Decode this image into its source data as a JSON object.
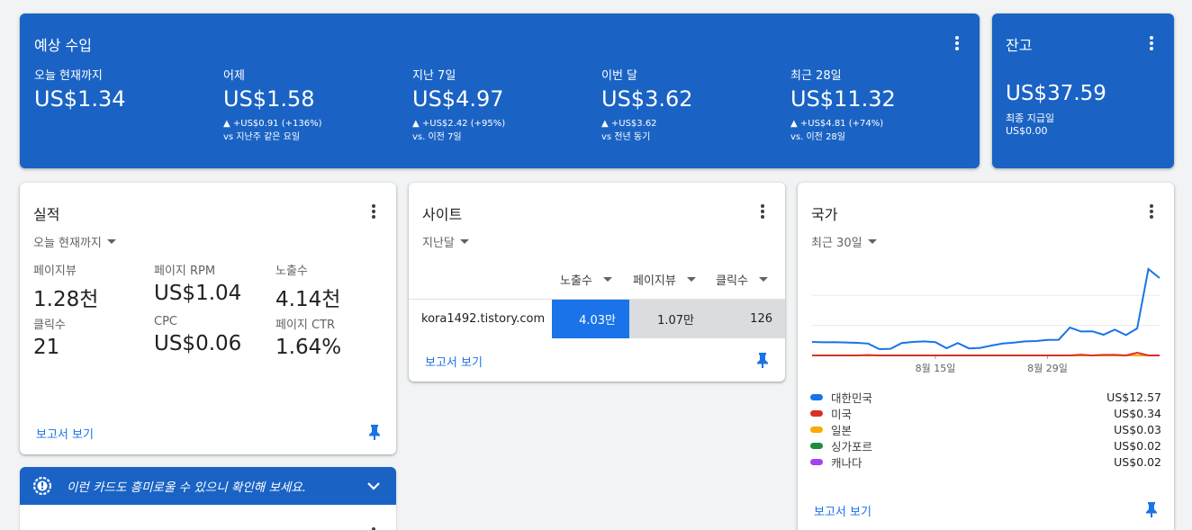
{
  "earnings": {
    "title": "예상 수입",
    "metrics": [
      {
        "label": "오늘 현재까지",
        "value": "US$1.34",
        "change": "",
        "compare": ""
      },
      {
        "label": "어제",
        "value": "US$1.58",
        "change": "▲ +US$0.91 (+136%)",
        "compare": "vs 지난주 같은 요일"
      },
      {
        "label": "지난 7일",
        "value": "US$4.97",
        "change": "▲ +US$2.42 (+95%)",
        "compare": "vs. 이전 7일"
      },
      {
        "label": "이번 달",
        "value": "US$3.62",
        "change": "▲ +US$3.62",
        "compare": "vs 전년 동기"
      },
      {
        "label": "최근 28일",
        "value": "US$11.32",
        "change": "▲ +US$4.81 (+74%)",
        "compare": "vs. 이전 28일"
      }
    ]
  },
  "balance": {
    "title": "잔고",
    "value": "US$37.59",
    "last_payment_label": "최종 지급일",
    "last_payment_value": "US$0.00"
  },
  "performance": {
    "title": "실적",
    "period": "오늘 현재까지",
    "metrics": [
      {
        "label": "페이지뷰",
        "value": "1.28천"
      },
      {
        "label": "페이지 RPM",
        "value": "US$1.04"
      },
      {
        "label": "노출수",
        "value": "4.14천"
      },
      {
        "label": "클릭수",
        "value": "21"
      },
      {
        "label": "CPC",
        "value": "US$0.06"
      },
      {
        "label": "페이지 CTR",
        "value": "1.64%"
      }
    ],
    "report_link": "보고서 보기"
  },
  "sites": {
    "title": "사이트",
    "period": "지난달",
    "columns": [
      "노출수",
      "페이지뷰",
      "클릭수"
    ],
    "rows": [
      {
        "site": "kora1492.tistory.com",
        "impressions": "4.03만",
        "pageviews": "1.07만",
        "clicks": "126"
      }
    ],
    "report_link": "보고서 보기"
  },
  "countries": {
    "title": "국가",
    "period": "최근 30일",
    "report_link": "보고서 보기",
    "legend": [
      {
        "name": "대한민국",
        "amount": "US$12.57",
        "color": "#1a73e8"
      },
      {
        "name": "미국",
        "amount": "US$0.34",
        "color": "#d93025"
      },
      {
        "name": "일본",
        "amount": "US$0.03",
        "color": "#f9ab00"
      },
      {
        "name": "싱가포르",
        "amount": "US$0.02",
        "color": "#1e8e3e"
      },
      {
        "name": "캐나다",
        "amount": "US$0.02",
        "color": "#a142f4"
      }
    ],
    "chart_data": {
      "type": "line",
      "x_ticks": [
        "8월 15일",
        "8월 29일"
      ],
      "series": [
        {
          "name": "대한민국",
          "color": "#1a73e8",
          "values": [
            0.75,
            0.73,
            0.74,
            0.72,
            0.7,
            0.66,
            0.35,
            0.37,
            0.69,
            0.75,
            0.78,
            0.74,
            0.4,
            0.69,
            0.39,
            0.42,
            0.55,
            0.66,
            0.71,
            0.78,
            0.8,
            0.86,
            0.87,
            1.55,
            1.33,
            1.34,
            1.15,
            1.43,
            1.13,
            1.5,
            4.8,
            4.3
          ]
        },
        {
          "name": "미국",
          "color": "#d93025",
          "values": [
            0,
            0,
            0,
            0,
            0,
            0.02,
            0,
            0,
            0,
            0,
            0,
            0,
            0,
            0,
            0,
            0,
            0,
            0,
            0,
            0,
            0,
            0,
            0,
            0,
            0.04,
            0,
            0.03,
            0.03,
            0,
            0.15,
            0,
            0
          ]
        },
        {
          "name": "일본",
          "color": "#f9ab00",
          "values": [
            0,
            0,
            0,
            0,
            0,
            0,
            0,
            0,
            0,
            0,
            0,
            0,
            0,
            0,
            0,
            0,
            0,
            0,
            0,
            0,
            0,
            0,
            0,
            0,
            0,
            0,
            0,
            0,
            0,
            0,
            0,
            0
          ]
        },
        {
          "name": "싱가포르",
          "color": "#1e8e3e",
          "values": [
            0,
            0,
            0,
            0,
            0,
            0,
            0,
            0,
            0,
            0,
            0,
            0,
            0,
            0,
            0,
            0,
            0,
            0,
            0,
            0,
            0,
            0,
            0,
            0,
            0,
            0,
            0,
            0,
            0,
            0,
            0,
            0
          ]
        },
        {
          "name": "캐나다",
          "color": "#a142f4",
          "values": [
            0,
            0,
            0,
            0,
            0,
            0,
            0,
            0,
            0,
            0,
            0,
            0,
            0,
            0,
            0,
            0,
            0,
            0,
            0,
            0,
            0,
            0,
            0,
            0,
            0,
            0,
            0,
            0,
            0,
            0,
            0,
            0
          ]
        }
      ]
    }
  },
  "notice": {
    "text": "이런 카드도 흥미로울 수 있으니 확인해 보세요."
  }
}
